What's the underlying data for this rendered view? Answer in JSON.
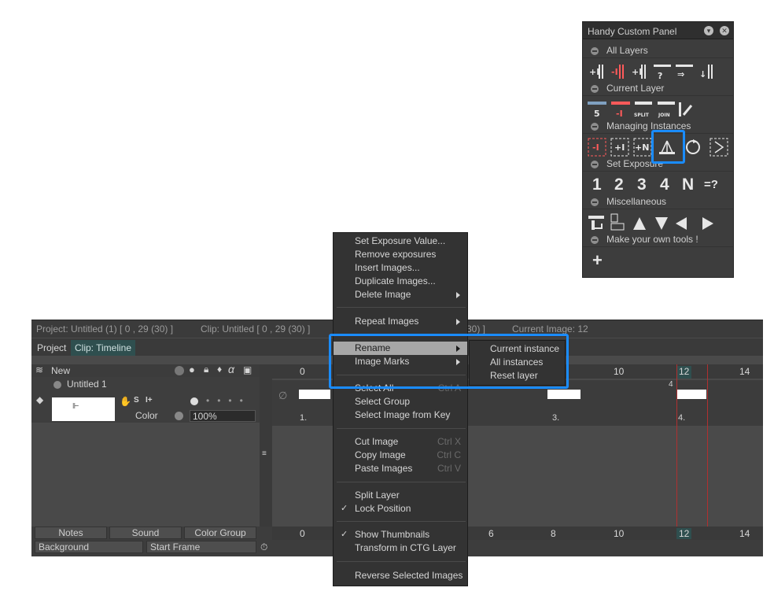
{
  "panel": {
    "title": "Handy Custom Panel",
    "sections": [
      {
        "label": "All Layers"
      },
      {
        "label": "Current Layer"
      },
      {
        "label": "Managing Instances"
      },
      {
        "label": "Set Exposure"
      },
      {
        "label": "Miscellaneous"
      },
      {
        "label": "Make your own tools !"
      }
    ],
    "current_layer_icons": [
      "5",
      "1",
      "SPLIT",
      "JOIN"
    ],
    "exposure_buttons": [
      "1",
      "2",
      "3",
      "4",
      "N",
      "=?"
    ],
    "instance_icons": [
      "-I",
      "+I",
      "+N"
    ],
    "add_tool": "+"
  },
  "timeline": {
    "project_info": "Project: Untitled (1) [ 0 , 29  (30) ]",
    "clip_info": "Clip: Untitled [ 0 , 29  (30) ]",
    "clip_info_tail": "30) ]",
    "current_image": "Current Image: 12",
    "tab_project": "Project",
    "tab_clip": "Clip: Timeline",
    "new_label": "New",
    "layer_name": "Untitled 1",
    "color_label": "Color",
    "opacity": "100%",
    "ruler_top": [
      "0",
      "10",
      "12",
      "14"
    ],
    "ruler_bottom": [
      "0",
      "6",
      "8",
      "10",
      "12",
      "14"
    ],
    "marks": [
      "1.",
      "3.",
      "4."
    ],
    "mark_4": "4",
    "notes": "Notes",
    "sound": "Sound",
    "color_group": "Color Group",
    "background": "Background",
    "start_frame": "Start Frame"
  },
  "menu": {
    "items": [
      {
        "label": "Set Exposure Value..."
      },
      {
        "label": "Remove exposures"
      },
      {
        "label": "Insert Images..."
      },
      {
        "label": "Duplicate Images..."
      },
      {
        "label": "Delete Image"
      },
      {
        "label": "Repeat Images"
      },
      {
        "label": "Rename"
      },
      {
        "label": "Image Marks"
      },
      {
        "label": "Select All",
        "shortcut": "Ctrl A"
      },
      {
        "label": "Select Group"
      },
      {
        "label": "Select Image from Key"
      },
      {
        "label": "Cut Image",
        "shortcut": "Ctrl X"
      },
      {
        "label": "Copy Image",
        "shortcut": "Ctrl C"
      },
      {
        "label": "Paste Images",
        "shortcut": "Ctrl V"
      },
      {
        "label": "Split Layer"
      },
      {
        "label": "Lock Position"
      },
      {
        "label": "Show Thumbnails"
      },
      {
        "label": "Transform in CTG Layer"
      },
      {
        "label": "Reverse Selected Images"
      }
    ],
    "check": "✓"
  },
  "submenu": {
    "items": [
      {
        "label": "Current instance"
      },
      {
        "label": "All instances"
      },
      {
        "label": "Reset layer"
      }
    ]
  },
  "colors": {
    "highlight": "#1a8cff",
    "accent": "#ff5a5a",
    "teal": "#2f4f4f"
  }
}
